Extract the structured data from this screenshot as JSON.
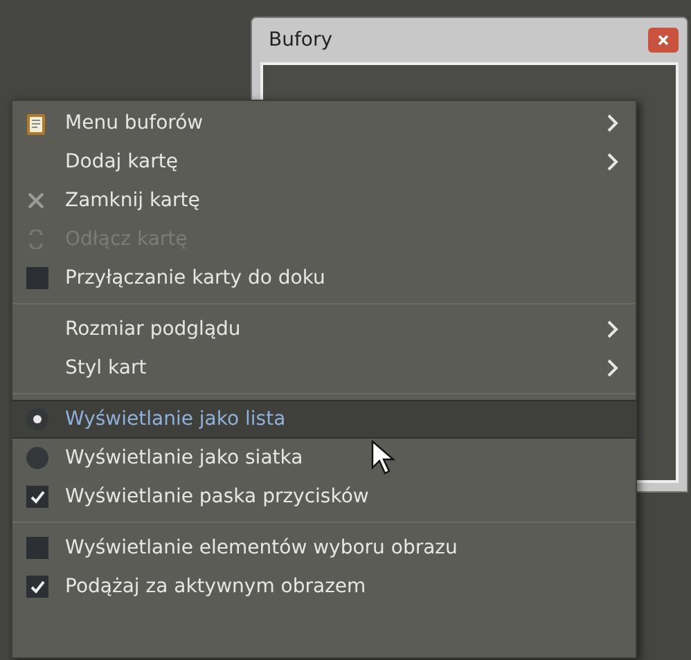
{
  "window": {
    "title": "Bufory"
  },
  "menu": [
    {
      "kind": "clipboard",
      "label": "Menu buforów",
      "submenu": true,
      "disabled": false,
      "selected": false
    },
    {
      "kind": "plain",
      "label": "Dodaj kartę",
      "submenu": true,
      "disabled": false,
      "selected": false
    },
    {
      "kind": "close",
      "label": "Zamknij kartę",
      "submenu": false,
      "disabled": false,
      "selected": false
    },
    {
      "kind": "detach",
      "label": "Odłącz kartę",
      "submenu": false,
      "disabled": true,
      "selected": false
    },
    {
      "kind": "checkbox",
      "label": "Przyłączanie karty do doku",
      "checked": false,
      "submenu": false,
      "disabled": false,
      "selected": false
    },
    {
      "kind": "separator"
    },
    {
      "kind": "plain",
      "label": "Rozmiar podglądu",
      "submenu": true,
      "disabled": false,
      "selected": false
    },
    {
      "kind": "plain",
      "label": "Styl kart",
      "submenu": true,
      "disabled": false,
      "selected": false
    },
    {
      "kind": "separator"
    },
    {
      "kind": "radio",
      "label": "Wyświetlanie jako lista",
      "checked": true,
      "submenu": false,
      "disabled": false,
      "selected": true
    },
    {
      "kind": "radio",
      "label": "Wyświetlanie jako siatka",
      "checked": false,
      "submenu": false,
      "disabled": false,
      "selected": false
    },
    {
      "kind": "checkbox",
      "label": "Wyświetlanie paska przycisków",
      "checked": true,
      "submenu": false,
      "disabled": false,
      "selected": false
    },
    {
      "kind": "separator"
    },
    {
      "kind": "checkbox",
      "label": "Wyświetlanie elementów wyboru obrazu",
      "checked": false,
      "submenu": false,
      "disabled": false,
      "selected": false
    },
    {
      "kind": "checkbox",
      "label": "Podążaj za aktywnym obrazem",
      "checked": true,
      "submenu": false,
      "disabled": false,
      "selected": false
    }
  ]
}
